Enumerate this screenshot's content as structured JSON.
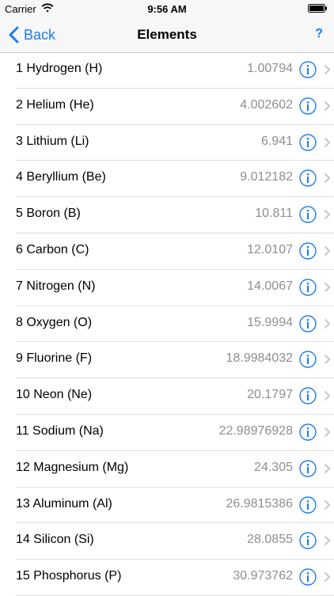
{
  "status": {
    "carrier": "Carrier",
    "time": "9:56 AM"
  },
  "nav": {
    "back_label": "Back",
    "title": "Elements",
    "help_label": "?"
  },
  "elements": [
    {
      "label": "1 Hydrogen (H)",
      "mass": "1.00794"
    },
    {
      "label": "2 Helium (He)",
      "mass": "4.002602"
    },
    {
      "label": "3 Lithium (Li)",
      "mass": "6.941"
    },
    {
      "label": "4 Beryllium (Be)",
      "mass": "9.012182"
    },
    {
      "label": "5 Boron (B)",
      "mass": "10.811"
    },
    {
      "label": "6 Carbon (C)",
      "mass": "12.0107"
    },
    {
      "label": "7 Nitrogen (N)",
      "mass": "14.0067"
    },
    {
      "label": "8 Oxygen (O)",
      "mass": "15.9994"
    },
    {
      "label": "9 Fluorine (F)",
      "mass": "18.9984032"
    },
    {
      "label": "10 Neon (Ne)",
      "mass": "20.1797"
    },
    {
      "label": "11 Sodium (Na)",
      "mass": "22.98976928"
    },
    {
      "label": "12 Magnesium (Mg)",
      "mass": "24.305"
    },
    {
      "label": "13 Aluminum (Al)",
      "mass": "26.9815386"
    },
    {
      "label": "14 Silicon (Si)",
      "mass": "28.0855"
    },
    {
      "label": "15 Phosphorus (P)",
      "mass": "30.973762"
    }
  ],
  "icons": {
    "info": "info-circle-icon",
    "chevron": "chevron-right-icon"
  },
  "colors": {
    "accent": "#1a7cf5",
    "secondary_text": "#8e8e93"
  }
}
